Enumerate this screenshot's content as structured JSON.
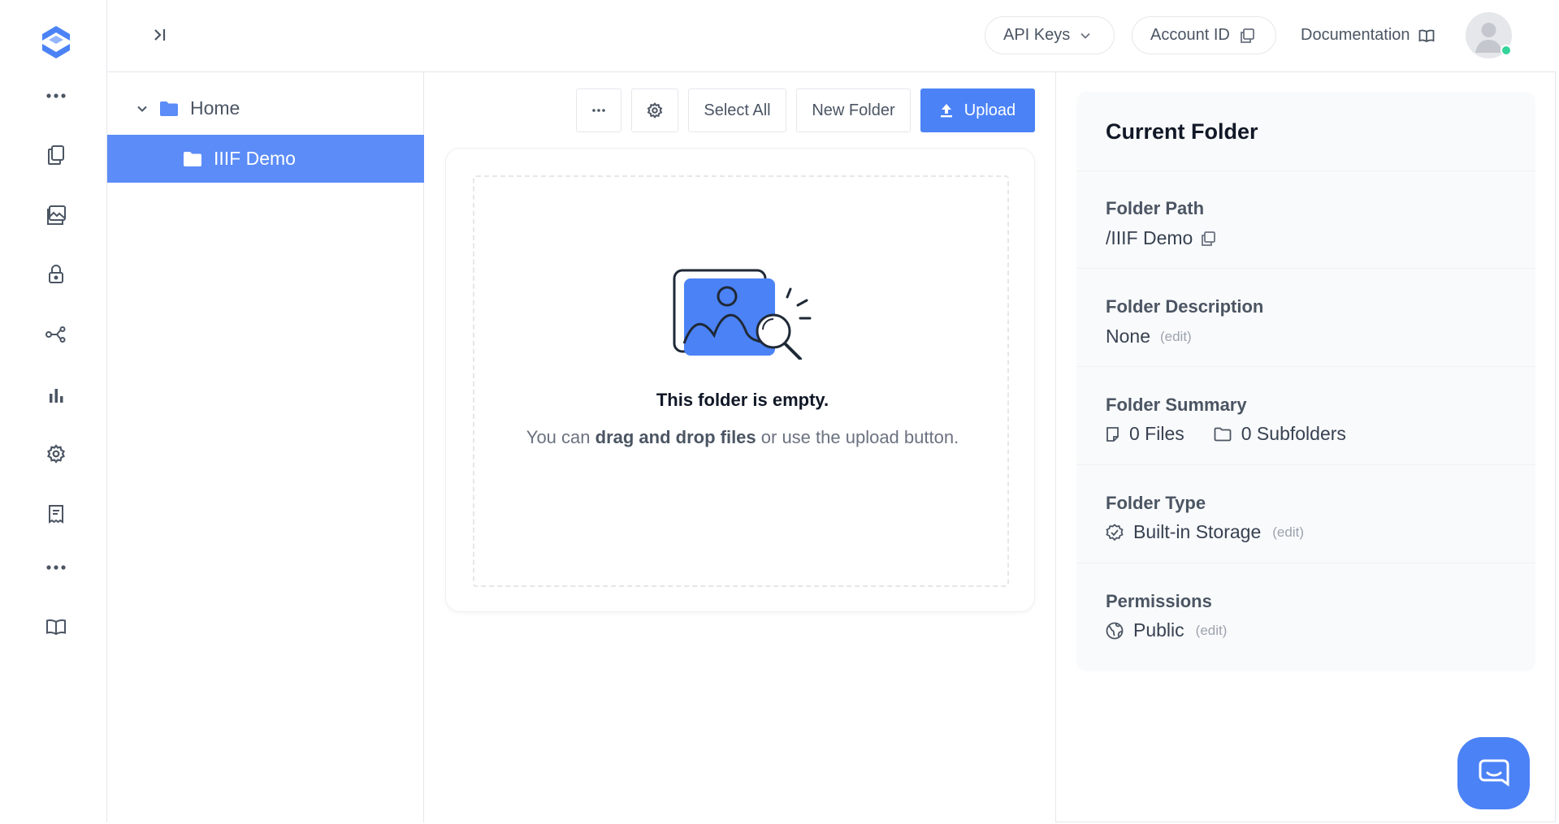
{
  "topbar": {
    "api_keys_label": "API Keys",
    "account_id_label": "Account ID",
    "documentation_label": "Documentation"
  },
  "rail": {
    "icons": [
      "logo-icon",
      "more-icon",
      "files-icon",
      "images-icon",
      "lock-icon",
      "share-icon",
      "analytics-icon",
      "settings-icon",
      "receipt-icon",
      "more-icon",
      "book-icon"
    ]
  },
  "tree": {
    "root_label": "Home",
    "child_label": "IIIF Demo"
  },
  "toolbar": {
    "more_label": "···",
    "select_all_label": "Select All",
    "new_folder_label": "New Folder",
    "upload_label": "Upload"
  },
  "empty_state": {
    "title": "This folder is empty.",
    "text_prefix": "You can ",
    "text_bold": "drag and drop files",
    "text_suffix": " or use the upload button."
  },
  "details": {
    "heading": "Current Folder",
    "path_label": "Folder Path",
    "path_value": "/IIIF Demo",
    "description_label": "Folder Description",
    "description_value": "None",
    "summary_label": "Folder Summary",
    "files_value": "0 Files",
    "subfolders_value": "0 Subfolders",
    "type_label": "Folder Type",
    "type_value": "Built-in Storage",
    "permissions_label": "Permissions",
    "permissions_value": "Public",
    "edit_label": "(edit)"
  },
  "colors": {
    "accent": "#4b82f6",
    "selected_row": "#5b8cf7",
    "status_online": "#34d399"
  }
}
